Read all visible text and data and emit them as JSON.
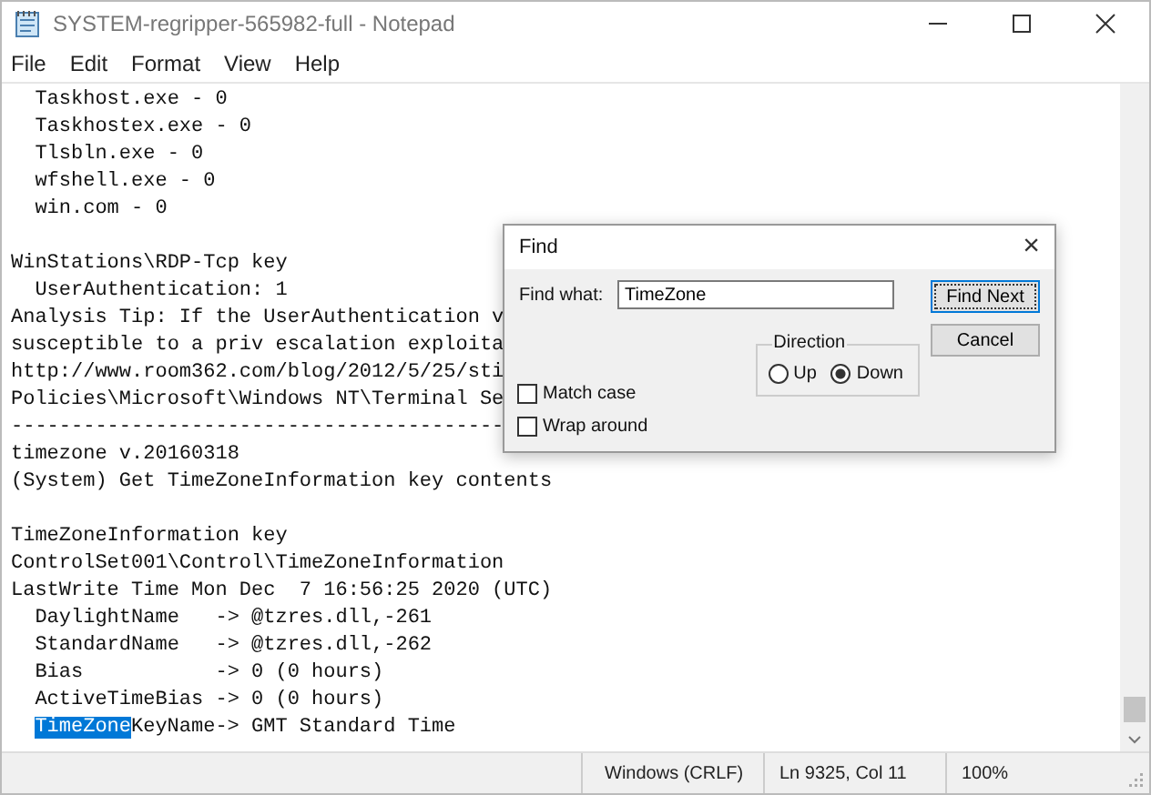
{
  "window": {
    "title": "SYSTEM-regripper-565982-full - Notepad"
  },
  "menu": [
    "File",
    "Edit",
    "Format",
    "View",
    "Help"
  ],
  "lines": [
    {
      "segments": [
        {
          "text": "  Taskhost.exe - 0",
          "selected": false
        }
      ]
    },
    {
      "segments": [
        {
          "text": "  Taskhostex.exe - 0",
          "selected": false
        }
      ]
    },
    {
      "segments": [
        {
          "text": "  Tlsbln.exe - 0",
          "selected": false
        }
      ]
    },
    {
      "segments": [
        {
          "text": "  wfshell.exe - 0",
          "selected": false
        }
      ]
    },
    {
      "segments": [
        {
          "text": "  win.com - 0",
          "selected": false
        }
      ]
    },
    {
      "kind": "blank"
    },
    {
      "segments": [
        {
          "text": "WinStations\\RDP-Tcp key",
          "selected": false
        }
      ]
    },
    {
      "segments": [
        {
          "text": "  UserAuthentication: 1",
          "selected": false
        }
      ]
    },
    {
      "segments": [
        {
          "text": "Analysis Tip: If the UserAuthentication v",
          "selected": false
        }
      ]
    },
    {
      "segments": [
        {
          "text": "susceptible to a priv escalation exploita",
          "selected": false
        }
      ]
    },
    {
      "segments": [
        {
          "text": "http://www.room362.com/blog/2012/5/25/sti",
          "selected": false
        }
      ]
    },
    {
      "segments": [
        {
          "text": "Policies\\Microsoft\\Windows NT\\Terminal Se",
          "selected": false
        }
      ]
    },
    {
      "segments": [
        {
          "text": "-----------------------------------------",
          "selected": false
        }
      ]
    },
    {
      "segments": [
        {
          "text": "timezone v.20160318",
          "selected": false
        }
      ]
    },
    {
      "segments": [
        {
          "text": "(System) Get TimeZoneInformation key contents",
          "selected": false
        }
      ]
    },
    {
      "kind": "blank"
    },
    {
      "segments": [
        {
          "text": "TimeZoneInformation key",
          "selected": false
        }
      ]
    },
    {
      "segments": [
        {
          "text": "ControlSet001\\Control\\TimeZoneInformation",
          "selected": false
        }
      ]
    },
    {
      "segments": [
        {
          "text": "LastWrite Time Mon Dec  7 16:56:25 2020 (UTC)",
          "selected": false
        }
      ]
    },
    {
      "segments": [
        {
          "text": "  DaylightName   -> @tzres.dll,-261",
          "selected": false
        }
      ]
    },
    {
      "segments": [
        {
          "text": "  StandardName   -> @tzres.dll,-262",
          "selected": false
        }
      ]
    },
    {
      "segments": [
        {
          "text": "  Bias           -> 0 (0 hours)",
          "selected": false
        }
      ]
    },
    {
      "segments": [
        {
          "text": "  ActiveTimeBias -> 0 (0 hours)",
          "selected": false
        }
      ]
    },
    {
      "indent": true,
      "segments": [
        {
          "text": "TimeZone",
          "selected": true
        },
        {
          "text": "KeyName-> GMT Standard Time",
          "selected": false
        }
      ]
    }
  ],
  "find_dialog": {
    "title": "Find",
    "close": "×",
    "find_what_label": "Find what:",
    "find_what_value": "TimeZone",
    "buttons": [
      {
        "label": "Find Next",
        "default": true
      },
      {
        "label": "Cancel",
        "default": false
      }
    ],
    "direction": {
      "label": "Direction",
      "options": [
        {
          "label": "Up",
          "selected": false
        },
        {
          "label": "Down",
          "selected": true
        }
      ]
    },
    "checkboxes": [
      {
        "label": "Match case",
        "checked": false
      },
      {
        "label": "Wrap around",
        "checked": false
      }
    ]
  },
  "status_bar": {
    "line_ending": "Windows (CRLF)",
    "position": "Ln 9325, Col 11",
    "zoom": "100%"
  }
}
